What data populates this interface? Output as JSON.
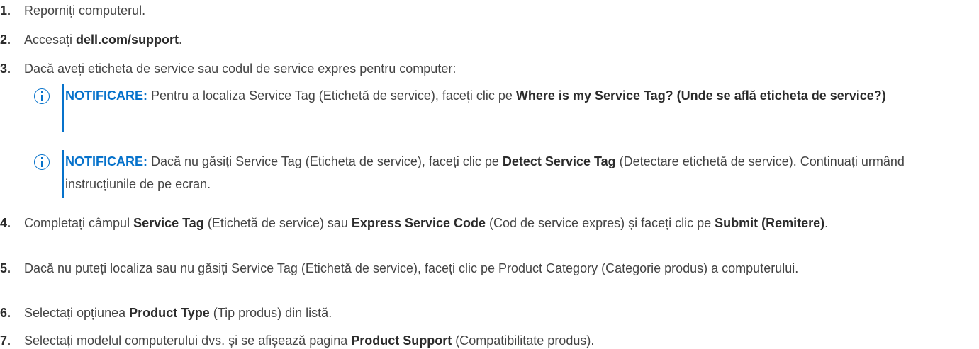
{
  "steps": [
    {
      "num": "1.",
      "t": [
        "Reporniți computerul."
      ]
    },
    {
      "num": "2.",
      "t": [
        "Accesați ",
        "dell.com/support",
        "."
      ]
    },
    {
      "num": "3.",
      "t": [
        "Dacă aveți eticheta de service sau codul de service expres pentru computer:"
      ]
    },
    {
      "num": "4.",
      "t": [
        "Completați câmpul ",
        "Service Tag",
        " (Etichetă de service) sau ",
        "Express Service Code",
        " (Cod de service expres) și faceți clic pe ",
        "Submit (Remitere)",
        "."
      ]
    },
    {
      "num": "5.",
      "t": [
        "Dacă nu puteți localiza sau nu găsiți Service Tag (Etichetă de service), faceți clic pe Product Category (Categorie produs) a computerului."
      ]
    },
    {
      "num": "6.",
      "t": [
        "Selectați opțiunea ",
        "Product Type",
        " (Tip produs) din listă."
      ]
    },
    {
      "num": "7.",
      "t": [
        "Selectați modelul computerului dvs. și se afișează pagina ",
        "Product Support",
        " (Compatibilitate produs)."
      ]
    }
  ],
  "notes": [
    {
      "label": "NOTIFICARE:",
      "t": [
        " Pentru a localiza Service Tag (Etichetă de service), faceți clic pe ",
        "Where is my Service Tag? (Unde se află eticheta de service?)"
      ]
    },
    {
      "label": "NOTIFICARE:",
      "t": [
        " Dacă nu găsiți Service Tag (Eticheta de service), faceți clic pe ",
        "Detect Service Tag",
        " (Detectare etichetă de service). Continuați urmând instrucțiunile de pe ecran."
      ]
    }
  ]
}
